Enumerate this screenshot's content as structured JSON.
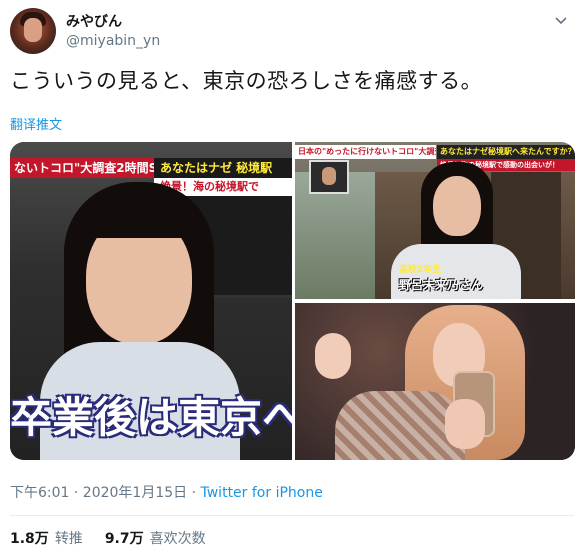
{
  "user": {
    "display_name": "みやびん",
    "handle": "@miyabin_yn",
    "avatar_icon": "user-avatar"
  },
  "menu_icon": "chevron-down-icon",
  "tweet": {
    "text": "こういうの見ると、東京の恐ろしさを痛感する。",
    "translate_label": "翻译推文"
  },
  "media": {
    "left": {
      "banner_top": "ないトコロ\"大調査2時間SP",
      "banner_mid": "あなたはナゼ 秘境駅",
      "banner_sub": "絶景！海の秘境駅で",
      "caption": "卒業後は東京へ"
    },
    "top_right": {
      "banner_left": "日本の\"めったに行けないトコロ\"大調査2時間SP",
      "banner_right": "あなたはナゼ秘境駅へ来たんですか？",
      "banner_sub": "絶景！海の秘境駅で感動の出会いが！",
      "caption_small": "高校2年生",
      "caption_name": "野呂未来乃さん"
    }
  },
  "meta": {
    "time": "下午6:01 · 2020年1月15日 · ",
    "via": "Twitter for iPhone"
  },
  "stats": {
    "retweets_count": "1.8万",
    "retweets_label": "转推",
    "likes_count": "9.7万",
    "likes_label": "喜欢次数"
  },
  "colors": {
    "accent": "#1b95e0",
    "banner_red": "#c4162a",
    "banner_yellow": "#f3e24a"
  }
}
